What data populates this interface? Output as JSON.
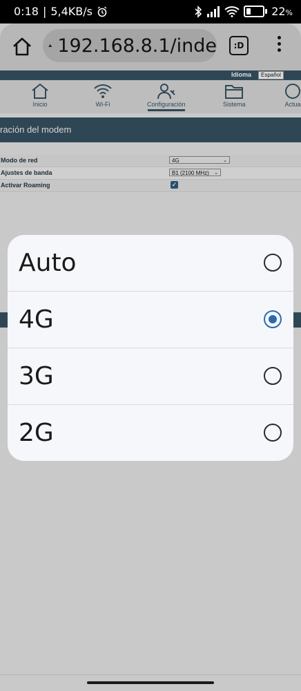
{
  "status_bar": {
    "time": "0:18",
    "net_speed": "5,4KB/s",
    "battery_percent": "22",
    "battery_level": 0.22,
    "icons": [
      "alarm-icon",
      "bluetooth-icon",
      "signal-icon",
      "wifi-icon",
      "battery-icon"
    ]
  },
  "browser": {
    "url": "192.168.8.1/inde",
    "tab_label": ":D"
  },
  "router": {
    "idioma_label": "Idioma",
    "language": "Español",
    "nav": [
      {
        "label": "Inicio",
        "icon": "home-icon"
      },
      {
        "label": "Wi-Fi",
        "icon": "wifi-icon"
      },
      {
        "label": "Configuración",
        "icon": "settings-user-icon"
      },
      {
        "label": "Sistema",
        "icon": "folder-icon"
      },
      {
        "label": "Actua",
        "icon": "update-icon"
      }
    ],
    "section_title": "ración del modem",
    "form": [
      {
        "label": "Modo de red",
        "value": "4G"
      },
      {
        "label": "Ajustes de banda",
        "value": "B1 (2100 MHz)"
      },
      {
        "label": "Activar Roaming",
        "checked": true
      }
    ]
  },
  "dialog": {
    "options": [
      {
        "label": "Auto",
        "selected": false
      },
      {
        "label": "4G",
        "selected": true
      },
      {
        "label": "3G",
        "selected": false
      },
      {
        "label": "2G",
        "selected": false
      }
    ]
  },
  "colors": {
    "accent": "#2a6bb0",
    "router_dark": "#2f4755"
  }
}
